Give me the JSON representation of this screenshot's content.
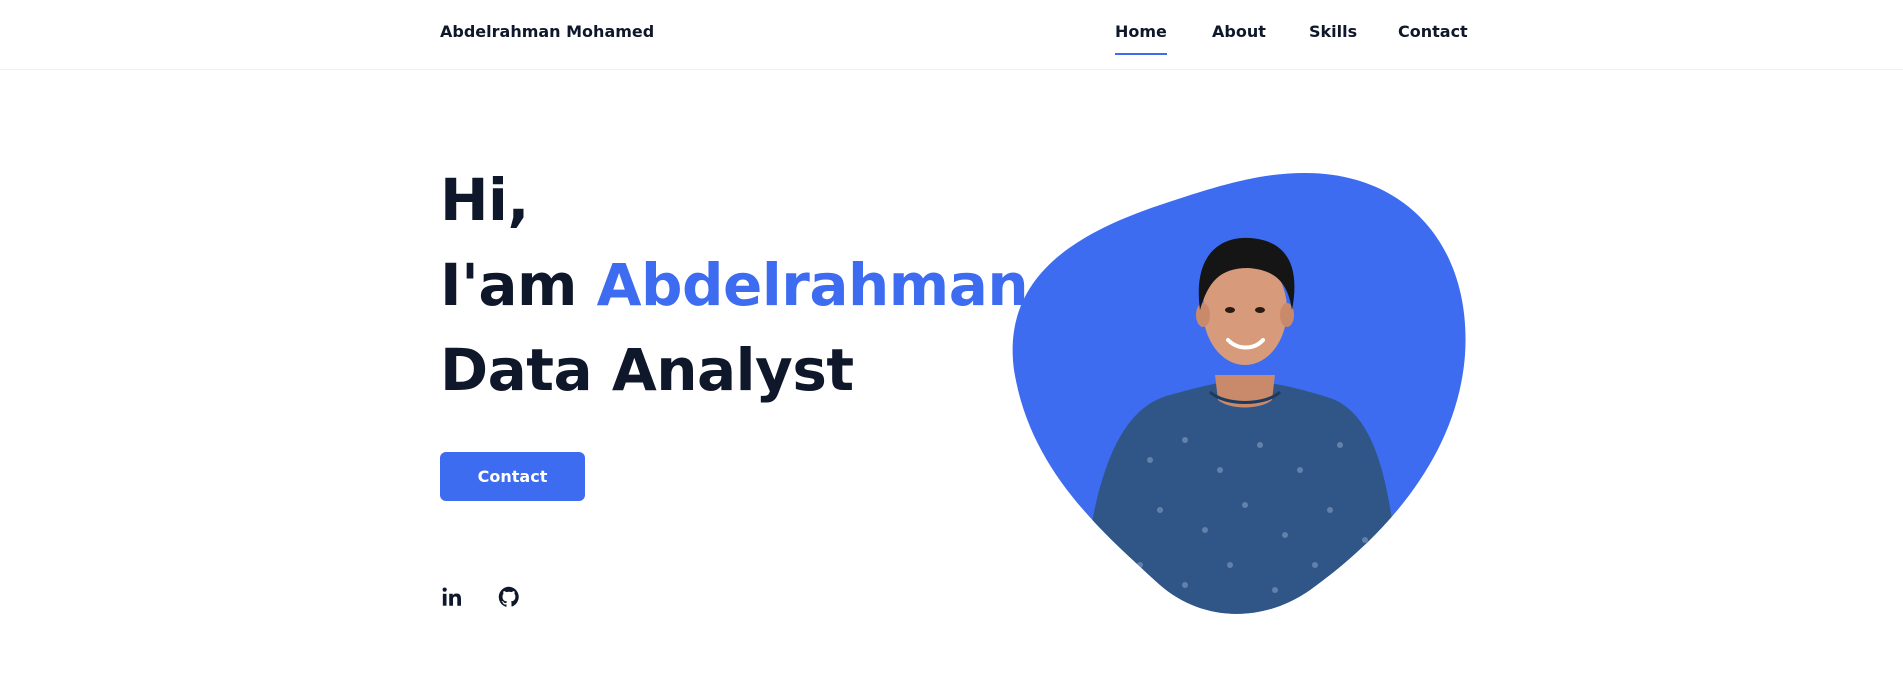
{
  "header": {
    "brand": "Abdelrahman Mohamed",
    "nav": [
      {
        "label": "Home",
        "active": true
      },
      {
        "label": "About",
        "active": false
      },
      {
        "label": "Skills",
        "active": false
      },
      {
        "label": "Contact",
        "active": false
      }
    ]
  },
  "hero": {
    "greeting": "Hi,",
    "intro_prefix": "I'am ",
    "name": "Abdelrahman",
    "role": "Data Analyst",
    "contact_button": "Contact"
  },
  "socials": [
    {
      "icon": "linkedin-icon"
    },
    {
      "icon": "github-icon"
    }
  ],
  "colors": {
    "accent": "#3d6cf0",
    "text": "#0f172a",
    "shirt": "#2f5686",
    "skin": "#d79a7a",
    "hair": "#151515"
  }
}
